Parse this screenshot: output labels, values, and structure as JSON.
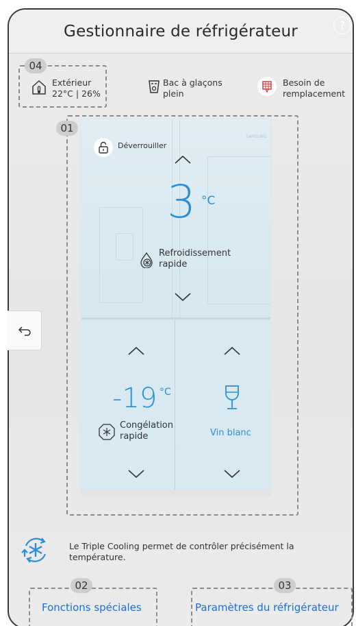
{
  "header": {
    "title": "Gestionnaire de réfrigérateur",
    "help_label": "?"
  },
  "badges": {
    "status": "04",
    "fridge": "01",
    "special": "02",
    "settings": "03"
  },
  "status": {
    "outdoor_label": "Extérieur",
    "outdoor_value": "22°C | 26%",
    "ice_line1": "Bac à glaçons",
    "ice_line2": "plein",
    "filter_line1": "Besoin de",
    "filter_line2": "remplacement"
  },
  "fridge": {
    "lock_label": "Déverrouiller",
    "fridge_temp": "3",
    "fridge_unit": "°C",
    "power_cool_line1": "Refroidissement",
    "power_cool_line2": "rapide",
    "freezer_temp": "-19",
    "freezer_unit": "°C",
    "power_freeze_line1": "Congélation",
    "power_freeze_line2": "rapide",
    "flex_mode": "Vin blanc",
    "brand_mark": "SAMSUNG"
  },
  "info": {
    "line1": "Le Triple Cooling permet de contrôler précisément la",
    "line2": "température."
  },
  "links": {
    "special_functions": "Fonctions spéciales",
    "fridge_settings": "Paramètres du réfrigérateur"
  },
  "colors": {
    "accent": "#2a8fd6",
    "link": "#1a6fd6",
    "alert": "#e0393e"
  }
}
